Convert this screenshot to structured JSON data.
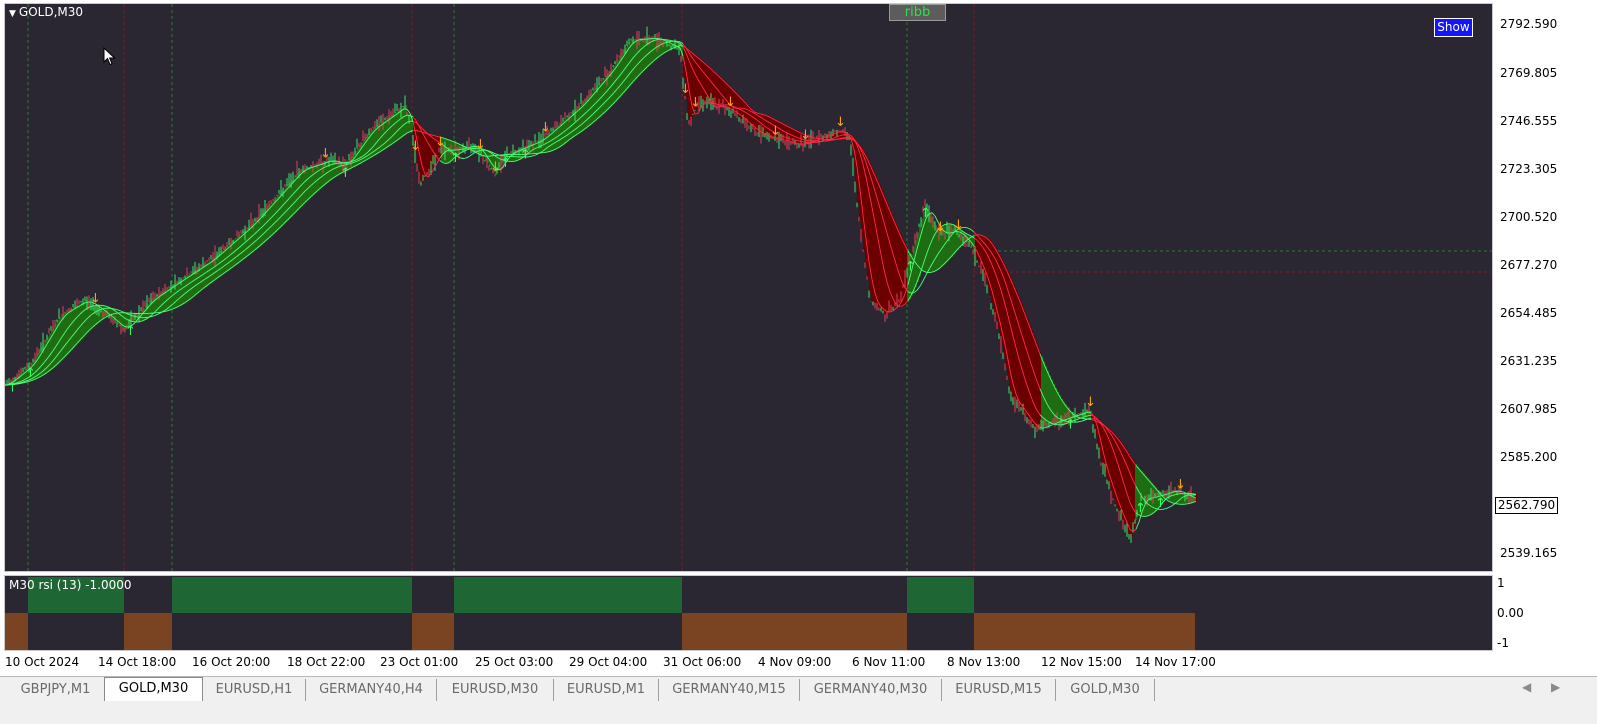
{
  "chart": {
    "title": "GOLD,M30",
    "indicator_button": "ribb",
    "show_button": "Show",
    "current_price": "2562.790",
    "price_axis": [
      "2792.590",
      "2769.805",
      "2746.555",
      "2723.305",
      "2700.520",
      "2677.270",
      "2654.485",
      "2631.235",
      "2607.985",
      "2585.200",
      "2539.165"
    ],
    "time_axis": [
      "10 Oct 2024",
      "14 Oct 18:00",
      "16 Oct 20:00",
      "18 Oct 22:00",
      "23 Oct 01:00",
      "25 Oct 03:00",
      "29 Oct 04:00",
      "31 Oct 06:00",
      "4 Nov 09:00",
      "6 Nov 11:00",
      "8 Nov 13:00",
      "12 Nov 15:00",
      "14 Nov 17:00"
    ],
    "colors": {
      "background": "#2a2733",
      "bull_ribbon": "#1f6d12",
      "bear_ribbon": "#6b0000",
      "bull_line": "#4dff7a",
      "bear_line": "#ff2a4a",
      "arrow_up": "#33ff66",
      "arrow_down": "#ffa500"
    }
  },
  "rsi": {
    "title": "M30 rsi  (13) -1.0000",
    "axis": [
      "1",
      "0.00",
      "-1"
    ],
    "colors": {
      "up": "#1e6634",
      "down": "#7a4322"
    }
  },
  "tabs": [
    {
      "label": "GBPJPY,M1",
      "active": false
    },
    {
      "label": "GOLD,M30",
      "active": true
    },
    {
      "label": "EURUSD,H1",
      "active": false
    },
    {
      "label": "GERMANY40,H4",
      "active": false
    },
    {
      "label": "EURUSD,M30",
      "active": false
    },
    {
      "label": "EURUSD,M1",
      "active": false
    },
    {
      "label": "GERMANY40,M15",
      "active": false
    },
    {
      "label": "GERMANY40,M30",
      "active": false
    },
    {
      "label": "EURUSD,M15",
      "active": false
    },
    {
      "label": "GOLD,M30",
      "active": false
    }
  ]
}
